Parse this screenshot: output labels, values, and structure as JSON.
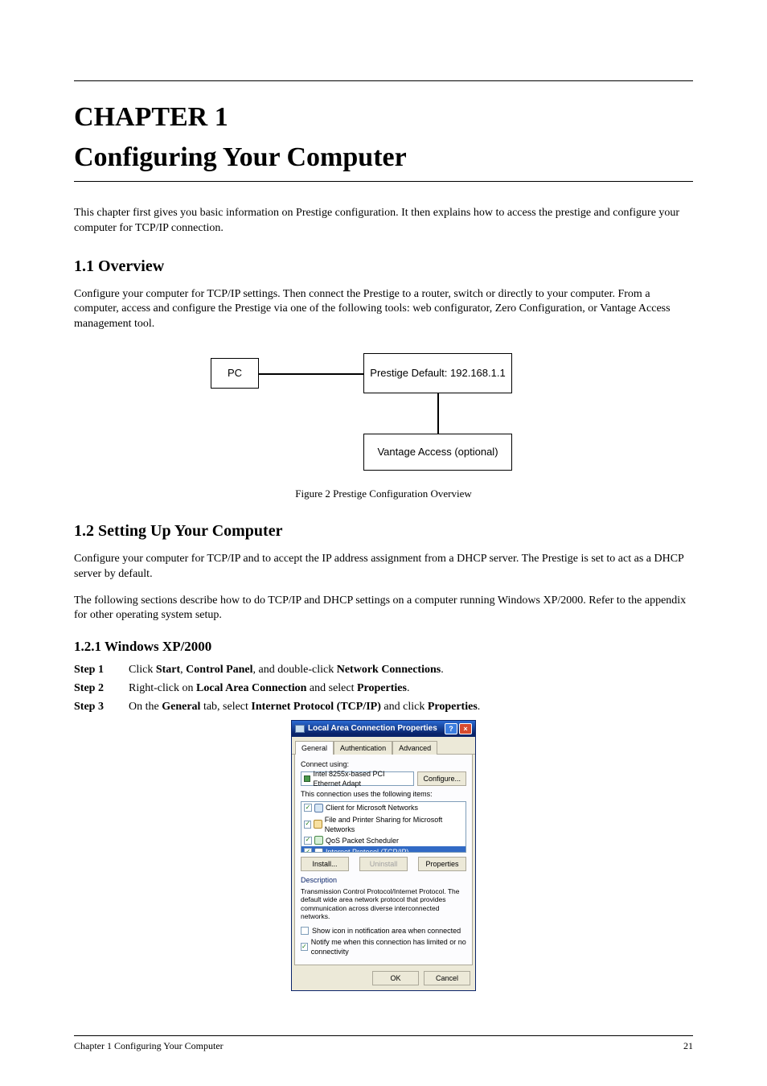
{
  "chapter_num": "1",
  "chapter_title": "Configuring Your Computer",
  "intro_para": "This chapter first gives you basic information on Prestige configuration. It then explains how to access the prestige and configure your computer for TCP/IP connection.",
  "sec1_title": "1.1  Overview",
  "sec1_para": "Configure your computer for TCP/IP settings. Then connect the Prestige to a router, switch or directly to your computer. From a computer, access and configure the Prestige via one of the following tools: web configurator, Zero Configuration, or Vantage Access management tool.",
  "fig1_caption": "Figure 2   Prestige Configuration Overview",
  "diagram": {
    "pc": "PC",
    "prestige": "Prestige Default: 192.168.1.1",
    "vantage": "Vantage Access (optional)"
  },
  "sec2_title": "1.2  Setting Up Your Computer",
  "sec2_p1": "Configure your computer for TCP/IP and to accept the IP address assignment from a DHCP server. The Prestige is set to act as a DHCP server by default.",
  "sec2_p2": "The following sections describe how to do TCP/IP and DHCP settings on a computer running Windows XP/2000. Refer to the appendix for other operating system setup.",
  "sub_title": "1.2.1  Windows XP/2000",
  "step1": {
    "label": "Step 1",
    "prefix": "Click ",
    "b1": "Start",
    "mid1": ", ",
    "b2": "Control Panel",
    "mid2": ", and double-click ",
    "b3": "Network Connections",
    "end": "."
  },
  "step2": {
    "label": "Step 2",
    "prefix": "Right-click on ",
    "b1": "Local Area Connection",
    "mid": " and select ",
    "b2": "Properties",
    "end": "."
  },
  "step3": {
    "label": "Step 3",
    "prefix": "On the ",
    "b1": "General",
    "mid1": " tab, select ",
    "b2": "Internet Protocol (TCP/IP)",
    "mid2": " and click ",
    "b3": "Properties",
    "end": "."
  },
  "dialog": {
    "title": "Local Area Connection Properties",
    "tabs": {
      "general": "General",
      "auth": "Authentication",
      "adv": "Advanced"
    },
    "connect_using": "Connect using:",
    "adapter": "Intel 8255x-based PCI Ethernet Adapt",
    "configure": "Configure...",
    "items_label": "This connection uses the following items:",
    "items": {
      "client": "Client for Microsoft Networks",
      "file": "File and Printer Sharing for Microsoft Networks",
      "qos": "QoS Packet Scheduler",
      "tcpip": "Internet Protocol (TCP/IP)"
    },
    "install": "Install...",
    "uninstall": "Uninstall",
    "properties": "Properties",
    "desc_label": "Description",
    "desc": "Transmission Control Protocol/Internet Protocol. The default wide area network protocol that provides communication across diverse interconnected networks.",
    "show_icon": "Show icon in notification area when connected",
    "notify": "Notify me when this connection has limited or no connectivity",
    "ok": "OK",
    "cancel": "Cancel"
  },
  "footer": {
    "left": "Chapter 1 Configuring Your Computer",
    "right": "21"
  }
}
